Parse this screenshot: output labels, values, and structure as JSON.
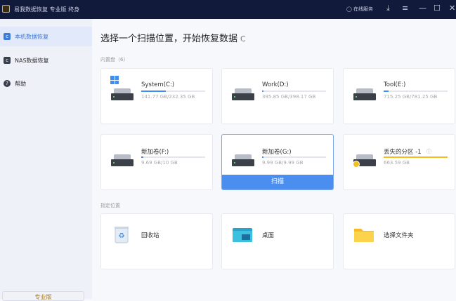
{
  "titlebar": {
    "title": "易我数据恢复 专业版 终身",
    "online_service": "在线服务",
    "icons": [
      "download-icon",
      "menu-icon",
      "minimize-icon",
      "maximize-icon",
      "close-icon"
    ]
  },
  "sidebar": {
    "items": [
      {
        "label": "本机数据恢复",
        "active": true
      },
      {
        "label": "NAS数据恢复"
      },
      {
        "label": "帮助"
      }
    ],
    "pro_button": "专业版"
  },
  "main": {
    "heading": "选择一个扫描位置，开始恢复数据",
    "refresh": "C",
    "internal_label": "内置盘（6）",
    "drives": [
      {
        "name": "System(C:)",
        "size": "141.77 GB/232.35 GB",
        "used_fraction": 0.39,
        "icon": "windows-drive"
      },
      {
        "name": "Work(D:)",
        "size": "395.85 GB/398.17 GB",
        "used_fraction": 0.01
      },
      {
        "name": "Tool(E:)",
        "size": "715.25 GB/781.25 GB",
        "used_fraction": 0.08
      },
      {
        "name": "新加卷(F:)",
        "size": "9.69 GB/10 GB",
        "used_fraction": 0.03
      },
      {
        "name": "新加卷(G:)",
        "size": "9.99 GB/9.99 GB",
        "used_fraction": 0.01,
        "selected": true
      },
      {
        "name": "丢失的分区 -1",
        "size": "663.59 GB",
        "used_fraction": 1.0,
        "lost": true,
        "bar_color": "#f4c020"
      }
    ],
    "scan_button": "扫描",
    "locations_label": "指定位置",
    "locations": [
      {
        "name": "回收站"
      },
      {
        "name": "桌面"
      },
      {
        "name": "选择文件夹"
      }
    ],
    "accent": "#4a8ef0"
  }
}
